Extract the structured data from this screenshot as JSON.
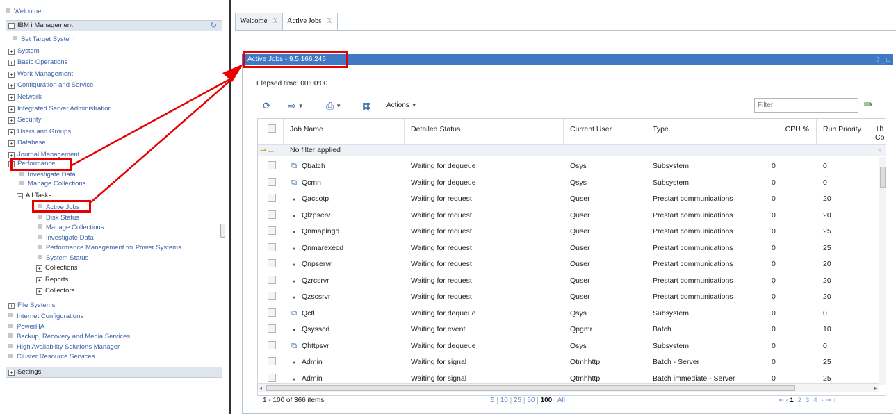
{
  "nav": {
    "welcome": "Welcome",
    "ibm_i_management": "IBM i Management",
    "items": [
      {
        "label": "Set Target System",
        "type": "leaf",
        "indent": 1
      },
      {
        "label": "System",
        "type": "plus",
        "indent": 0
      },
      {
        "label": "Basic Operations",
        "type": "plus",
        "indent": 0
      },
      {
        "label": "Work Management",
        "type": "plus",
        "indent": 0
      },
      {
        "label": "Configuration and Service",
        "type": "plus",
        "indent": 0
      },
      {
        "label": "Network",
        "type": "plus",
        "indent": 0
      },
      {
        "label": "Integrated Server Administration",
        "type": "plus",
        "indent": 0
      },
      {
        "label": "Security",
        "type": "plus",
        "indent": 0
      },
      {
        "label": "Users and Groups",
        "type": "plus",
        "indent": 0
      },
      {
        "label": "Database",
        "type": "plus",
        "indent": 0
      },
      {
        "label": "Journal Management",
        "type": "plus",
        "indent": 0
      }
    ],
    "performance": "Performance",
    "perf_children": [
      "Investigate Data",
      "Manage Collections"
    ],
    "all_tasks": "All Tasks",
    "all_tasks_children": [
      "Active Jobs",
      "Disk Status",
      "Manage Collections",
      "Investigate Data",
      "Performance Management for Power Systems",
      "System Status"
    ],
    "all_tasks_groups": [
      "Collections",
      "Reports",
      "Collectors"
    ],
    "bottom_items": [
      {
        "label": "File Systems",
        "type": "plus"
      },
      {
        "label": "Internet Configurations",
        "type": "leaf"
      },
      {
        "label": "PowerHA",
        "type": "leaf"
      },
      {
        "label": "Backup, Recovery and Media Services",
        "type": "leaf"
      },
      {
        "label": "High Availability Solutions Manager",
        "type": "leaf"
      },
      {
        "label": "Cluster Resource Services",
        "type": "leaf"
      }
    ],
    "settings": "Settings"
  },
  "tabs": [
    {
      "label": "Welcome",
      "close": "X"
    },
    {
      "label": "Active Jobs",
      "close": "X"
    }
  ],
  "panel": {
    "title": "Active Jobs - 9.5.166.245",
    "window_controls": "? _ □",
    "elapsed": "Elapsed time: 00:00:00",
    "actions_label": "Actions",
    "filter_placeholder": "Filter"
  },
  "table": {
    "columns": [
      "Job Name",
      "Detailed Status",
      "Current User",
      "Type",
      "CPU %",
      "Run Priority",
      "Th Co"
    ],
    "filter_row_text": "No filter applied",
    "filter_row_icon": "⇒ ...",
    "rows": [
      {
        "icon": "subsystem",
        "name": "Qbatch",
        "status": "Waiting for dequeue",
        "user": "Qsys",
        "type": "Subsystem",
        "cpu": "0",
        "priority": "0"
      },
      {
        "icon": "subsystem",
        "name": "Qcmn",
        "status": "Waiting for dequeue",
        "user": "Qsys",
        "type": "Subsystem",
        "cpu": "0",
        "priority": "0"
      },
      {
        "icon": "job",
        "name": "Qacsotp",
        "status": "Waiting for request",
        "user": "Quser",
        "type": "Prestart communications",
        "cpu": "0",
        "priority": "20"
      },
      {
        "icon": "job",
        "name": "Qlzpserv",
        "status": "Waiting for request",
        "user": "Quser",
        "type": "Prestart communications",
        "cpu": "0",
        "priority": "20"
      },
      {
        "icon": "job",
        "name": "Qnmapingd",
        "status": "Waiting for request",
        "user": "Quser",
        "type": "Prestart communications",
        "cpu": "0",
        "priority": "25"
      },
      {
        "icon": "job",
        "name": "Qnmarexecd",
        "status": "Waiting for request",
        "user": "Quser",
        "type": "Prestart communications",
        "cpu": "0",
        "priority": "25"
      },
      {
        "icon": "job",
        "name": "Qnpservr",
        "status": "Waiting for request",
        "user": "Quser",
        "type": "Prestart communications",
        "cpu": "0",
        "priority": "20"
      },
      {
        "icon": "job",
        "name": "Qzrcsrvr",
        "status": "Waiting for request",
        "user": "Quser",
        "type": "Prestart communications",
        "cpu": "0",
        "priority": "20"
      },
      {
        "icon": "job",
        "name": "Qzscsrvr",
        "status": "Waiting for request",
        "user": "Quser",
        "type": "Prestart communications",
        "cpu": "0",
        "priority": "20"
      },
      {
        "icon": "subsystem",
        "name": "Qctl",
        "status": "Waiting for dequeue",
        "user": "Qsys",
        "type": "Subsystem",
        "cpu": "0",
        "priority": "0"
      },
      {
        "icon": "job",
        "name": "Qsysscd",
        "status": "Waiting for event",
        "user": "Qpgmr",
        "type": "Batch",
        "cpu": "0",
        "priority": "10"
      },
      {
        "icon": "subsystem",
        "name": "Qhttpsvr",
        "status": "Waiting for dequeue",
        "user": "Qsys",
        "type": "Subsystem",
        "cpu": "0",
        "priority": "0"
      },
      {
        "icon": "job",
        "name": "Admin",
        "status": "Waiting for signal",
        "user": "Qtmhhttp",
        "type": "Batch - Server",
        "cpu": "0",
        "priority": "25"
      },
      {
        "icon": "job",
        "name": "Admin",
        "status": "Waiting for signal",
        "user": "Qtmhhttp",
        "type": "Batch immediate - Server",
        "cpu": "0",
        "priority": "25"
      }
    ]
  },
  "footer": {
    "item_count": "1 - 100 of 366 items",
    "page_sizes": [
      "5",
      "10",
      "25",
      "50",
      "100",
      "All"
    ],
    "current_page_size": "100",
    "pager": [
      "1",
      "2",
      "3",
      "4"
    ],
    "current_page": "1"
  },
  "colors": {
    "annotation": "#e60000",
    "panel_header": "#3f79c5",
    "link": "#3a62a8"
  }
}
